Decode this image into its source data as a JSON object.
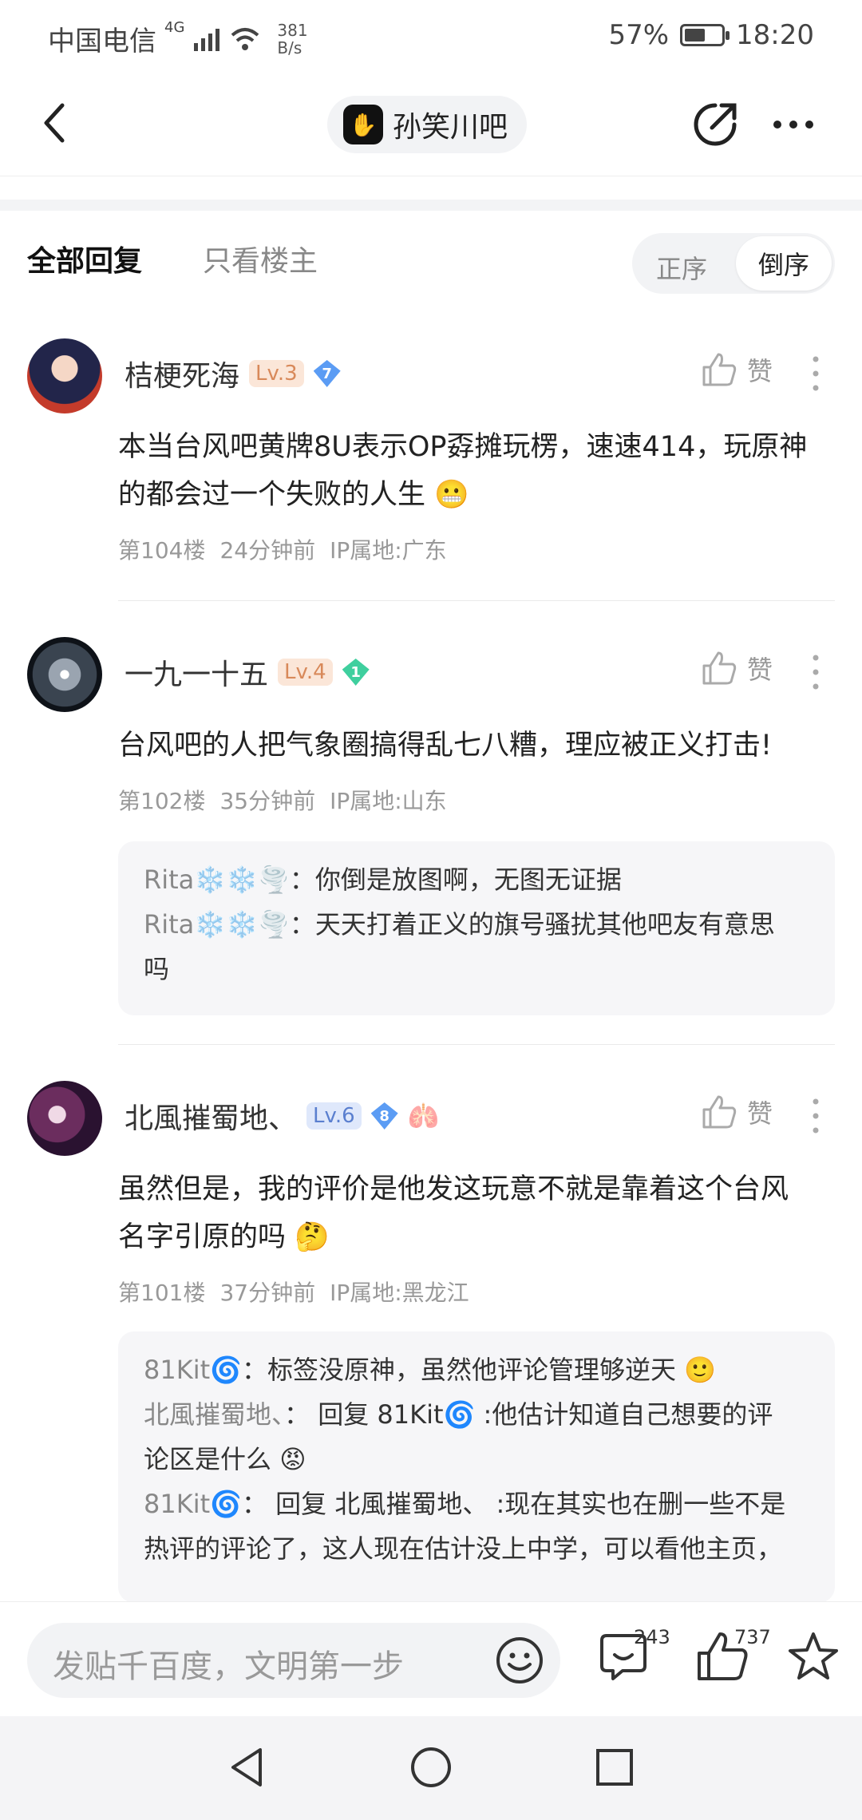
{
  "status_bar": {
    "carrier": "中国电信",
    "network": "4G",
    "speed_value": "381",
    "speed_unit": "B/s",
    "battery": "57%",
    "battery_level": 0.57,
    "time": "18:20"
  },
  "header": {
    "forum_name": "孙笑川吧",
    "back_icon": "chevron-left-icon",
    "share_icon": "share-edit-icon",
    "more_icon": "more-horizontal-icon"
  },
  "tabs": {
    "all_replies": "全部回复",
    "op_only": "只看楼主",
    "order_asc": "正序",
    "order_desc": "倒序"
  },
  "like_label": "赞",
  "posts": [
    {
      "username": "桔梗死海",
      "level": "Lv.3",
      "badge": "7",
      "text_line1": "本当台风吧黄牌8U表示OP孬摊玩楞，速速414，玩原神",
      "text_line2": "的都会过一个失败的人生",
      "floor": "第104楼",
      "time": "24分钟前",
      "ip": "IP属地:广东"
    },
    {
      "username": "一九一十五",
      "level": "Lv.4",
      "badge": "1",
      "text_line1": "台风吧的人把气象圈搞得乱七八糟，理应被正义打击!",
      "floor": "第102楼",
      "time": "35分钟前",
      "ip": "IP属地:山东",
      "replies": [
        {
          "who": "Rita❄️❄️🌪️",
          "text": "你倒是放图啊，无图无证据"
        },
        {
          "who": "Rita❄️❄️🌪️",
          "text": "天天打着正义的旗号骚扰其他吧友有意思",
          "text2": "吗"
        }
      ]
    },
    {
      "username": "北風摧蜀地、",
      "level": "Lv.6",
      "badge": "8",
      "text_line1": "虽然但是，我的评价是他发这玩意不就是靠着这个台风",
      "text_line2": "名字引原的吗",
      "floor": "第101楼",
      "time": "37分钟前",
      "ip": "IP属地:黑龙江",
      "replies": [
        {
          "who": "81Kit🌀",
          "text": "标签没原神，虽然他评论管理够逆天 🙂"
        },
        {
          "who": "北風摧蜀地、",
          "text": "回复 81Kit🌀 :他估计知道自己想要的评",
          "text2": "论区是什么"
        },
        {
          "who": "81Kit🌀",
          "text": "回复 北風摧蜀地、 :现在其实也在删一些不是",
          "text2": "热评的评论了，这人现在估计没上中学，可以看他主页，"
        }
      ]
    }
  ],
  "bottom_bar": {
    "input_placeholder": "发贴千百度，文明第一步",
    "comments_count": "243",
    "likes_count": "737"
  },
  "colors": {
    "lv3_bg": "#fbe6d8",
    "lv3_fg": "#d8895a",
    "lv6_bg": "#dfe8fb",
    "lv6_fg": "#5a7fcf",
    "gem_blue": "#5b9cf4",
    "gem_green": "#3fcf9e"
  }
}
